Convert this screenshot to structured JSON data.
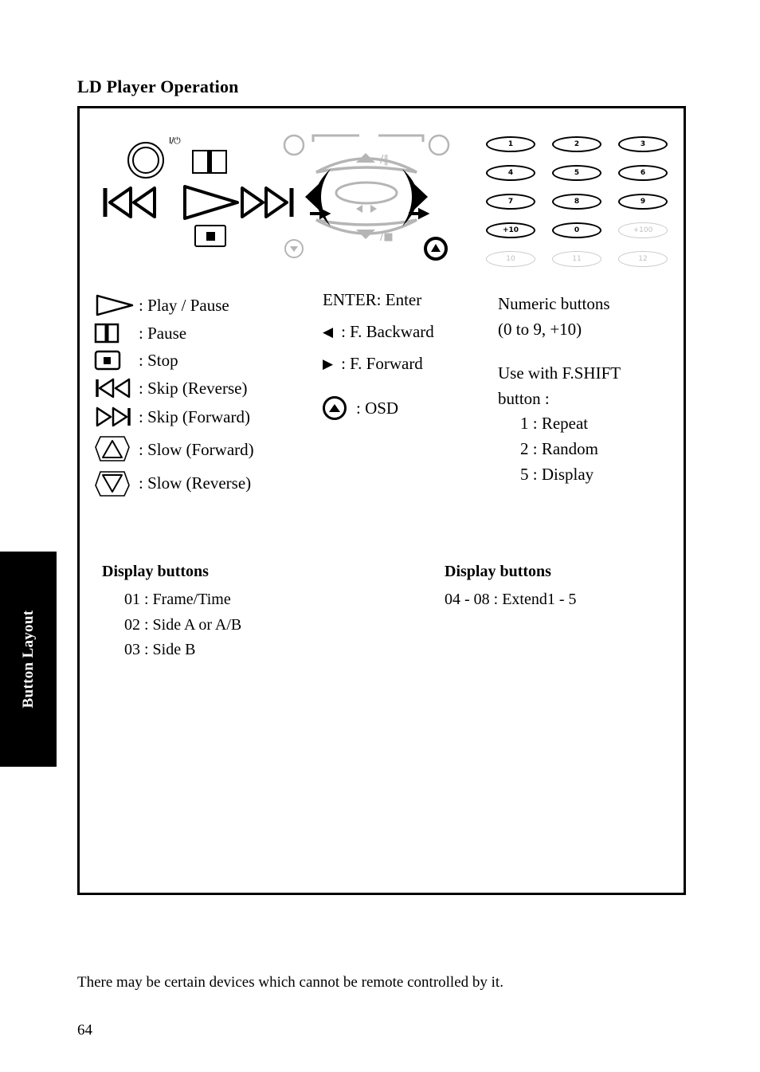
{
  "side_tab": {
    "label": "Button Layout"
  },
  "page_title": "LD Player Operation",
  "remote": {
    "power_label": "I/⏻",
    "keypad": {
      "rows": [
        [
          {
            "label": "1",
            "enabled": true
          },
          {
            "label": "2",
            "enabled": true
          },
          {
            "label": "3",
            "enabled": true
          }
        ],
        [
          {
            "label": "4",
            "enabled": true
          },
          {
            "label": "5",
            "enabled": true
          },
          {
            "label": "6",
            "enabled": true
          }
        ],
        [
          {
            "label": "7",
            "enabled": true
          },
          {
            "label": "8",
            "enabled": true
          },
          {
            "label": "9",
            "enabled": true
          }
        ],
        [
          {
            "label": "+10",
            "enabled": true
          },
          {
            "label": "0",
            "enabled": true
          },
          {
            "label": "+100",
            "enabled": false
          }
        ],
        [
          {
            "label": "10",
            "enabled": false
          },
          {
            "label": "11",
            "enabled": false
          },
          {
            "label": "12",
            "enabled": false
          }
        ]
      ]
    },
    "nav": {
      "up_label": "/‖",
      "down_label": "/■"
    }
  },
  "legend_left": [
    {
      "icon": "play-icon",
      "text": ": Play / Pause"
    },
    {
      "icon": "pause-icon",
      "text": ": Pause"
    },
    {
      "icon": "stop-icon",
      "text": ": Stop"
    },
    {
      "icon": "skip-reverse-icon",
      "text": ": Skip (Reverse)"
    },
    {
      "icon": "skip-forward-icon",
      "text": ": Skip (Forward)"
    },
    {
      "icon": "slow-forward-icon",
      "text": ": Slow (Forward)"
    },
    {
      "icon": "slow-reverse-icon",
      "text": ": Slow (Reverse)"
    }
  ],
  "legend_mid": {
    "enter": "ENTER: Enter",
    "backward_arrow": "◀",
    "backward": ": F. Backward",
    "forward_arrow": "▶",
    "forward": ": F. Forward",
    "osd": ": OSD"
  },
  "legend_right": {
    "line1": "Numeric buttons",
    "line2": "(0 to 9, +10)",
    "line3": "Use with F.SHIFT",
    "line4": "button :",
    "items": [
      "1  :  Repeat",
      "2  :  Random",
      "5  :  Display"
    ]
  },
  "display_left": {
    "heading": "Display buttons",
    "items": [
      "01  :  Frame/Time",
      "02  :  Side A or A/B",
      "03  :  Side B"
    ]
  },
  "display_right": {
    "heading": "Display buttons",
    "items": [
      "04 - 08 : Extend1 - 5"
    ]
  },
  "footer_note": "There may be certain devices which cannot be remote controlled by it.",
  "page_number": "64",
  "colors": {
    "ink": "#000000",
    "gray_button": "#c9c9c9",
    "gray_text": "#c0c0c0",
    "nav_gray": "#b5b5b5"
  }
}
